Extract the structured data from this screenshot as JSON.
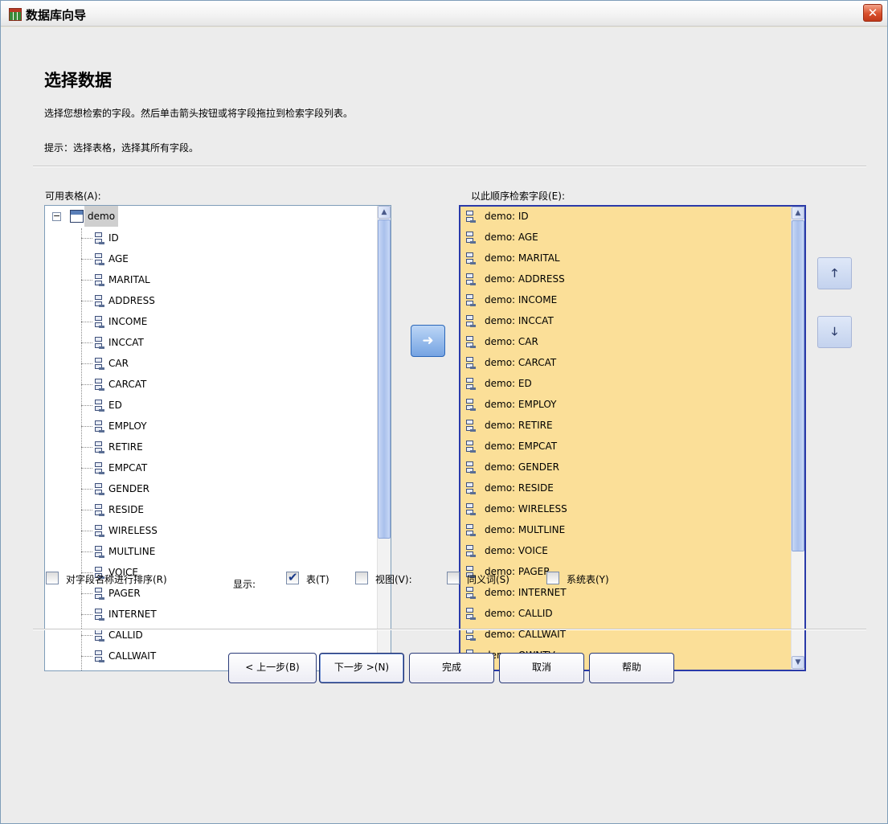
{
  "window": {
    "title": "数据库向导"
  },
  "page": {
    "heading": "选择数据",
    "description": "选择您想检索的字段。然后单击箭头按钮或将字段拖拉到检索字段列表。",
    "hint": "提示：选择表格，选择其所有字段。"
  },
  "available": {
    "label": "可用表格(A):",
    "table": "demo",
    "fields": [
      "ID",
      "AGE",
      "MARITAL",
      "ADDRESS",
      "INCOME",
      "INCCAT",
      "CAR",
      "CARCAT",
      "ED",
      "EMPLOY",
      "RETIRE",
      "EMPCAT",
      "GENDER",
      "RESIDE",
      "WIRELESS",
      "MULTLINE",
      "VOICE",
      "PAGER",
      "INTERNET",
      "CALLID",
      "CALLWAIT"
    ]
  },
  "selected": {
    "label": "以此顺序检索字段(E):",
    "fields": [
      "demo: ID",
      "demo: AGE",
      "demo: MARITAL",
      "demo: ADDRESS",
      "demo: INCOME",
      "demo: INCCAT",
      "demo: CAR",
      "demo: CARCAT",
      "demo: ED",
      "demo: EMPLOY",
      "demo: RETIRE",
      "demo: EMPCAT",
      "demo: GENDER",
      "demo: RESIDE",
      "demo: WIRELESS",
      "demo: MULTLINE",
      "demo: VOICE",
      "demo: PAGER",
      "demo: INTERNET",
      "demo: CALLID",
      "demo: CALLWAIT",
      "demo: OWNTV"
    ]
  },
  "options": {
    "sort_label": "对字段名称进行排序(R)",
    "sort_checked": false,
    "display_label": "显示:",
    "display": [
      {
        "label": "表(T)",
        "checked": true
      },
      {
        "label": "视图(V):",
        "checked": false
      },
      {
        "label": "同义词(S)",
        "checked": false
      },
      {
        "label": "系统表(Y)",
        "checked": false
      }
    ]
  },
  "buttons": {
    "back": "< 上一步(B)",
    "next": "下一步 >(N)",
    "finish": "完成",
    "cancel": "取消",
    "help": "帮助"
  },
  "icons": {
    "app": "database-wizard-icon",
    "close": "close-icon",
    "move": "arrow-right-icon",
    "up": "arrow-up-icon",
    "down": "arrow-down-icon"
  }
}
